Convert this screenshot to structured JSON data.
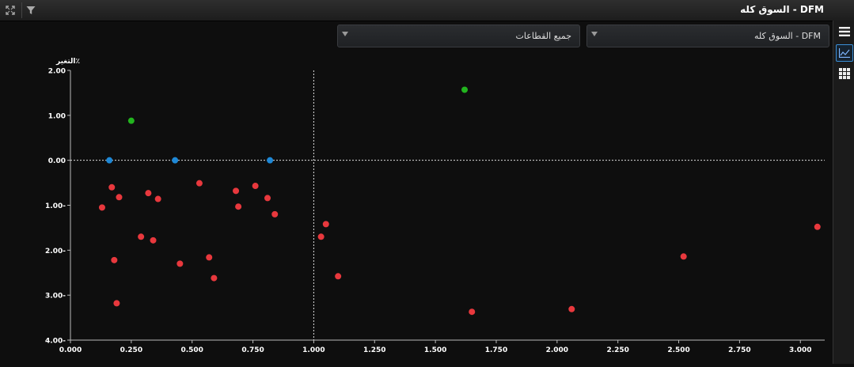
{
  "window": {
    "title": "DFM - السوق كله"
  },
  "filters": {
    "market": "DFM - السوق كله",
    "sector": "جميع القطاعات"
  },
  "icons": {
    "expand": "expand-icon",
    "filter": "filter-icon",
    "list": "list-icon",
    "chart": "line-chart-icon",
    "grid": "grid-icon"
  },
  "colors": {
    "negative": "#e8383d",
    "neutral": "#1e88d6",
    "positive": "#22b41e",
    "axis": "#bbbbbb",
    "reference_line": "#dddddd"
  },
  "chart_data": {
    "type": "scatter",
    "ylabel": "التغير٪",
    "xlabel": "",
    "xlim": [
      0.0,
      3.1
    ],
    "ylim": [
      -4.0,
      2.0
    ],
    "x_ticks": [
      "0.000",
      "0.250",
      "0.500",
      "0.750",
      "1.000",
      "1.250",
      "1.500",
      "1.750",
      "2.000",
      "2.250",
      "2.500",
      "2.750",
      "3.000"
    ],
    "y_ticks": [
      "2.00",
      "1.00",
      "0.00",
      "1.00-",
      "2.00-",
      "3.00-",
      "4.00-"
    ],
    "reference_lines": {
      "x": 1.0,
      "y": 0.0
    },
    "series": [
      {
        "color_key": "positive",
        "points": [
          [
            0.25,
            0.88
          ],
          [
            1.62,
            1.57
          ]
        ]
      },
      {
        "color_key": "neutral",
        "points": [
          [
            0.16,
            0.0
          ],
          [
            0.43,
            0.0
          ],
          [
            0.82,
            0.0
          ]
        ]
      },
      {
        "color_key": "negative",
        "points": [
          [
            0.13,
            -1.05
          ],
          [
            0.17,
            -0.6
          ],
          [
            0.2,
            -0.82
          ],
          [
            0.18,
            -2.22
          ],
          [
            0.19,
            -3.18
          ],
          [
            0.29,
            -1.7
          ],
          [
            0.32,
            -0.73
          ],
          [
            0.34,
            -1.78
          ],
          [
            0.36,
            -0.86
          ],
          [
            0.45,
            -2.3
          ],
          [
            0.53,
            -0.51
          ],
          [
            0.57,
            -2.16
          ],
          [
            0.59,
            -2.62
          ],
          [
            0.68,
            -0.68
          ],
          [
            0.69,
            -1.03
          ],
          [
            0.76,
            -0.57
          ],
          [
            0.81,
            -0.84
          ],
          [
            0.84,
            -1.2
          ],
          [
            1.03,
            -1.7
          ],
          [
            1.05,
            -1.42
          ],
          [
            1.1,
            -2.58
          ],
          [
            1.65,
            -3.37
          ],
          [
            2.06,
            -3.31
          ],
          [
            2.52,
            -2.14
          ],
          [
            3.07,
            -1.48
          ]
        ]
      }
    ]
  }
}
